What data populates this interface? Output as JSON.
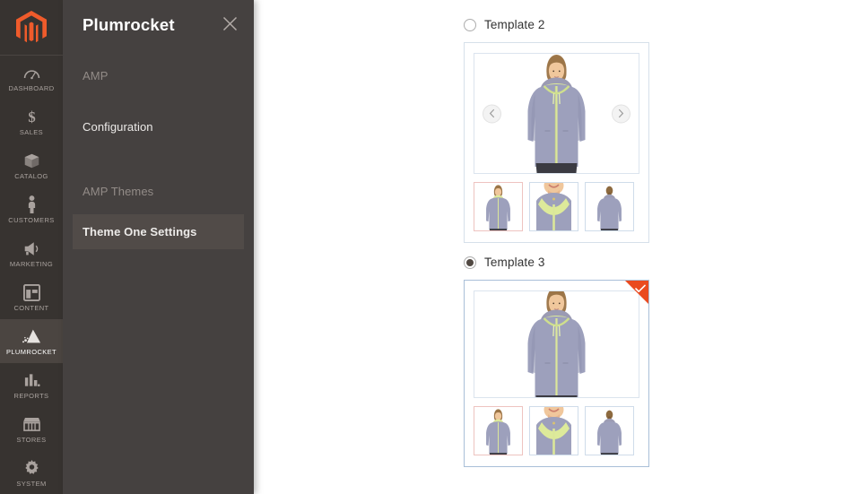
{
  "rail": {
    "logo_icon": "magento-logo-icon",
    "items": [
      {
        "label": "DASHBOARD",
        "icon": "gauge-icon",
        "active": false
      },
      {
        "label": "SALES",
        "icon": "dollar-icon",
        "active": false
      },
      {
        "label": "CATALOG",
        "icon": "box-icon",
        "active": false
      },
      {
        "label": "CUSTOMERS",
        "icon": "person-icon",
        "active": false
      },
      {
        "label": "MARKETING",
        "icon": "megaphone-icon",
        "active": false
      },
      {
        "label": "CONTENT",
        "icon": "layout-icon",
        "active": false
      },
      {
        "label": "PLUMROCKET",
        "icon": "mountain-icon",
        "active": true
      },
      {
        "label": "REPORTS",
        "icon": "bar-chart-icon",
        "active": false
      },
      {
        "label": "STORES",
        "icon": "storefront-icon",
        "active": false
      },
      {
        "label": "SYSTEM",
        "icon": "gear-icon",
        "active": false
      }
    ]
  },
  "flyout": {
    "title": "Plumrocket",
    "close_icon": "close-icon",
    "sections": [
      {
        "heading": "AMP",
        "links": [
          {
            "label": "Configuration",
            "active": false
          }
        ]
      },
      {
        "heading": "AMP Themes",
        "links": [
          {
            "label": "Theme One Settings",
            "active": true
          }
        ]
      }
    ]
  },
  "main": {
    "templates": [
      {
        "label": "Template 2",
        "selected": false,
        "has_nav_arrows": true,
        "prev_icon": "chevron-left-icon",
        "next_icon": "chevron-right-icon",
        "check_icon": "check-icon",
        "thumbnails": [
          {
            "view": "full-body-front",
            "active": true
          },
          {
            "view": "close-up-collar",
            "active": false
          },
          {
            "view": "full-body-back",
            "active": false
          }
        ]
      },
      {
        "label": "Template 3",
        "selected": true,
        "has_nav_arrows": false,
        "prev_icon": "chevron-left-icon",
        "next_icon": "chevron-right-icon",
        "check_icon": "check-icon",
        "thumbnails": [
          {
            "view": "full-body-front",
            "active": true
          },
          {
            "view": "close-up-collar",
            "active": false
          },
          {
            "view": "full-body-back",
            "active": false
          }
        ]
      }
    ]
  },
  "colors": {
    "rail_bg": "#373330",
    "flyout_bg": "#454140",
    "accent_orange": "#ea4b20",
    "selected_border": "#a9bfd8",
    "thumb_active_border": "#eec3c0",
    "thumb_border": "#cfdcea"
  }
}
